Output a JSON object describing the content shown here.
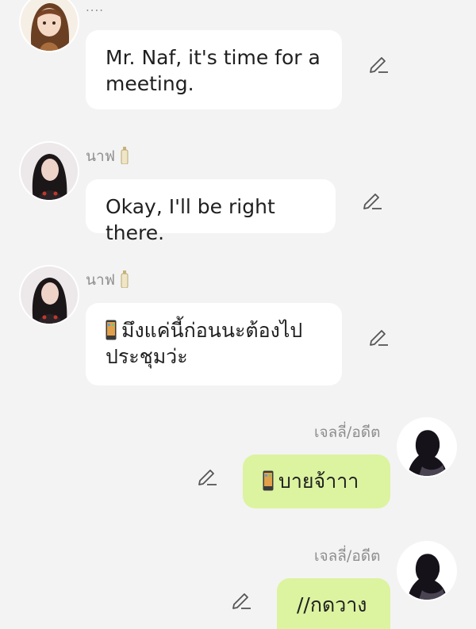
{
  "messages": [
    {
      "side": "left",
      "name": "....",
      "text_lines": [
        "Mr. Naf, it's time for a",
        "meeting."
      ]
    },
    {
      "side": "left",
      "name": "นาฟ",
      "text_lines": [
        "Okay, I'll be right there."
      ]
    },
    {
      "side": "left",
      "name": "นาฟ",
      "text_lines": [
        "มึงแค่นี้ก่อนนะต้องไป",
        "ประชุมว่ะ"
      ]
    },
    {
      "side": "right",
      "name": "เจลลี่/อดีต",
      "text_lines": [
        "บายจ้าาา"
      ]
    },
    {
      "side": "right",
      "name": "เจลลี่/อดีต",
      "text_lines": [
        "//กดวาง"
      ]
    }
  ],
  "icons": {
    "edit": "pencil-edit-icon",
    "phone": "mobile-phone-emoji-icon",
    "bottle": "bottle-emoji-icon"
  },
  "colors": {
    "background": "#f3f3f3",
    "bubble_left": "#ffffff",
    "bubble_right": "#dcf3a0",
    "name": "#8e8e8e"
  }
}
